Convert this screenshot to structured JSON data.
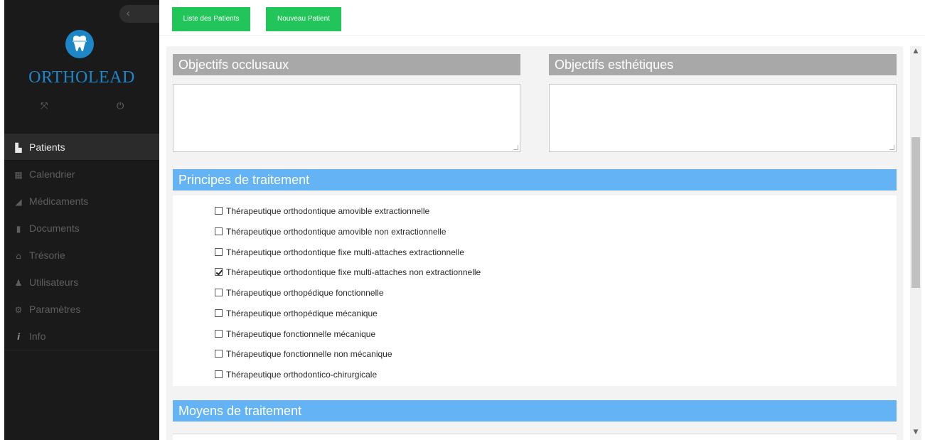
{
  "sidebar": {
    "collapse_glyph": "‹",
    "brand": "ORTHOLEAD",
    "logo_icon": "tooth-icon",
    "expand_glyph": "⤧",
    "power_glyph": "⏻",
    "items": [
      {
        "label": "Patients",
        "icon": "users-icon",
        "glyph": "▙",
        "active": true
      },
      {
        "label": "Calendrier",
        "icon": "calendar-icon",
        "glyph": "▦",
        "active": false
      },
      {
        "label": "Médicaments",
        "icon": "pill-icon",
        "glyph": "◢",
        "active": false
      },
      {
        "label": "Documents",
        "icon": "document-icon",
        "glyph": "▮",
        "active": false
      },
      {
        "label": "Trésorie",
        "icon": "bank-icon",
        "glyph": "⌂",
        "active": false
      },
      {
        "label": "Utilisateurs",
        "icon": "user-icon",
        "glyph": "♟",
        "active": false
      },
      {
        "label": "Paramètres",
        "icon": "gears-icon",
        "glyph": "⚙",
        "active": false
      },
      {
        "label": "Info",
        "icon": "info-icon",
        "glyph": "i",
        "active": false
      }
    ]
  },
  "toolbar": {
    "list_patients_label": "Liste des Patients",
    "new_patient_label": "Nouveau Patient",
    "button_color": "#22c55a"
  },
  "objectives": {
    "occlusal_title": "Objectifs occlusaux",
    "occlusal_value": "",
    "esthetic_title": "Objectifs esthétiques",
    "esthetic_value": ""
  },
  "principles": {
    "title": "Principes de traitement",
    "options": [
      {
        "label": "Thérapeutique orthodontique amovible extractionnelle",
        "checked": false
      },
      {
        "label": "Thérapeutique orthodontique amovible non extractionnelle",
        "checked": false
      },
      {
        "label": "Thérapeutique orthodontique fixe multi-attaches extractionnelle",
        "checked": false
      },
      {
        "label": "Thérapeutique orthodontique fixe multi-attaches non extractionnelle",
        "checked": true
      },
      {
        "label": "Thérapeutique orthopédique fonctionnelle",
        "checked": false
      },
      {
        "label": "Thérapeutique orthopédique mécanique",
        "checked": false
      },
      {
        "label": "Thérapeutique fonctionnelle mécanique",
        "checked": false
      },
      {
        "label": "Thérapeutique fonctionnelle non mécanique",
        "checked": false
      },
      {
        "label": "Thérapeutique orthodontico-chirurgicale",
        "checked": false
      }
    ]
  },
  "means": {
    "title": "Moyens de traitement"
  },
  "colors": {
    "section_blue": "#63b3f5",
    "section_gray": "#a8a8a8",
    "brand_blue": "#1e86c8"
  }
}
